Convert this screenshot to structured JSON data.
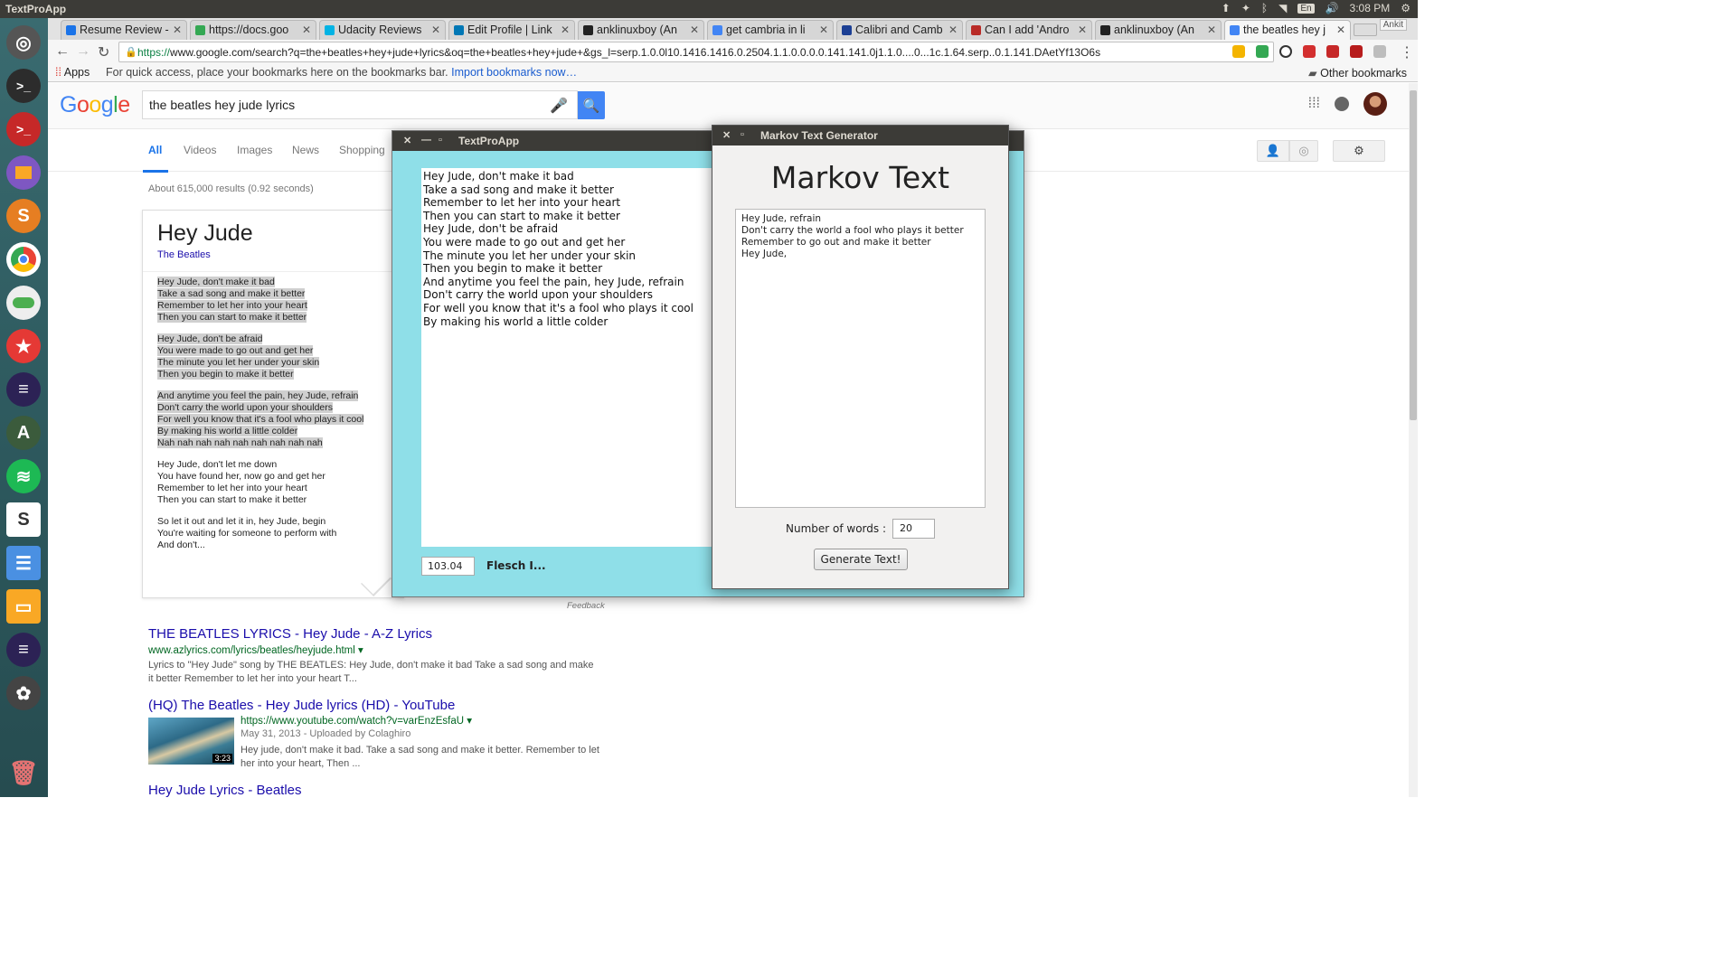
{
  "panel": {
    "app_name": "TextProApp",
    "keyboard_lang": "En",
    "clock": "3:08 PM",
    "user": "Ankit"
  },
  "tabs": [
    {
      "label": "Resume Review -",
      "color": "#1a73e8"
    },
    {
      "label": "https://docs.goo",
      "color": "#34a853"
    },
    {
      "label": "Udacity Reviews",
      "color": "#02b3e4"
    },
    {
      "label": "Edit Profile | Link",
      "color": "#0077b5"
    },
    {
      "label": "anklinuxboy (An",
      "color": "#222222"
    },
    {
      "label": "get cambria in li",
      "color": "#4285f4"
    },
    {
      "label": "Calibri and Camb",
      "color": "#1c3f94"
    },
    {
      "label": "Can I add 'Andro",
      "color": "#b92b27"
    },
    {
      "label": "anklinuxboy (An",
      "color": "#222222"
    },
    {
      "label": "the beatles hey j",
      "color": "#4285f4"
    }
  ],
  "toolbar": {
    "url_https": "https://",
    "url_rest": "www.google.com/search?q=the+beatles+hey+jude+lyrics&oq=the+beatles+hey+jude+&gs_l=serp.1.0.0l10.1416.1416.0.2504.1.1.0.0.0.0.141.141.0j1.1.0....0...1c.1.64.serp..0.1.141.DAetYf13O6s"
  },
  "bookmarks": {
    "apps": "Apps",
    "hint": "For quick access, place your bookmarks here on the bookmarks bar.",
    "import_link": "Import bookmarks now…",
    "other": "Other bookmarks"
  },
  "google": {
    "logo_letters": [
      "G",
      "o",
      "o",
      "g",
      "l",
      "e"
    ],
    "logo_colors": [
      "#4285f4",
      "#ea4335",
      "#fbbc05",
      "#4285f4",
      "#34a853",
      "#ea4335"
    ],
    "query": "the beatles hey jude lyrics",
    "tabs": [
      "All",
      "Videos",
      "Images",
      "News",
      "Shopping"
    ],
    "stats": "About 615,000 results (0.92 seconds)",
    "feedback": "Feedback"
  },
  "lyrics_card": {
    "title": "Hey Jude",
    "artist": "The Beatles",
    "stanzas": [
      [
        "Hey Jude, don't make it bad",
        "Take a sad song and make it better",
        "Remember to let her into your heart",
        "Then you can start to make it better"
      ],
      [
        "Hey Jude, don't be afraid",
        "You were made to go out and get her",
        "The minute you let her under your skin",
        "Then you begin to make it better"
      ],
      [
        "And anytime you feel the pain, hey Jude, refrain",
        "Don't carry the world upon your shoulders",
        "For well you know that it's a fool who plays it cool",
        "By making his world a little colder",
        "Nah nah nah nah nah nah nah nah nah"
      ],
      [
        "Hey Jude, don't let me down",
        "You have found her, now go and get her",
        "Remember to let her into your heart",
        "Then you can start to make it better"
      ],
      [
        "So let it out and let it in, hey Jude, begin",
        "You're waiting for someone to perform with",
        "And don't..."
      ]
    ]
  },
  "results": [
    {
      "title": "THE BEATLES LYRICS - Hey Jude - A-Z Lyrics",
      "url": "www.azlyrics.com/lyrics/beatles/heyjude.html",
      "snippet_1": "Lyrics to \"Hey Jude\" song by THE BEATLES: Hey Jude, don't make it bad Take a sad song and make",
      "snippet_2": "it better Remember to let her into your heart T..."
    },
    {
      "title": "(HQ) The Beatles - Hey Jude lyrics (HD) - YouTube",
      "url": "https://www.youtube.com/watch?v=varEnzEsfaU",
      "meta": "May 31, 2013 - Uploaded by Colaghiro",
      "snippet_1": "Hey jude, don't make it bad. Take a sad song and make it better. Remember to let",
      "snippet_2": "her into your heart, Then ...",
      "duration": "3:23"
    },
    {
      "title": "Hey Jude Lyrics - Beatles"
    }
  ],
  "textpro": {
    "title": "TextProApp",
    "lines": [
      "Hey Jude, don't make it bad",
      "Take a sad song and make it better",
      "Remember to let her into your heart",
      "Then you can start to make it better",
      "Hey Jude, don't be afraid",
      "You were made to go out and get her",
      "The minute you let her under your skin",
      "Then you begin to make it better",
      "And anytime you feel the pain, hey Jude, refrain",
      "Don't carry the world upon your shoulders",
      "For well you know that it's a fool who plays it cool",
      "By making his world a little colder"
    ],
    "score": "103.04",
    "score_label": "Flesch I..."
  },
  "markov": {
    "title": "Markov Text Generator",
    "heading": "Markov Text",
    "output_lines": [
      "Hey Jude, refrain",
      "Don't carry the world a fool who plays it better",
      "Remember to go out and make it better",
      "Hey Jude,"
    ],
    "words_label": "Number of words :",
    "words_value": "20",
    "generate_label": "Generate Text!"
  }
}
